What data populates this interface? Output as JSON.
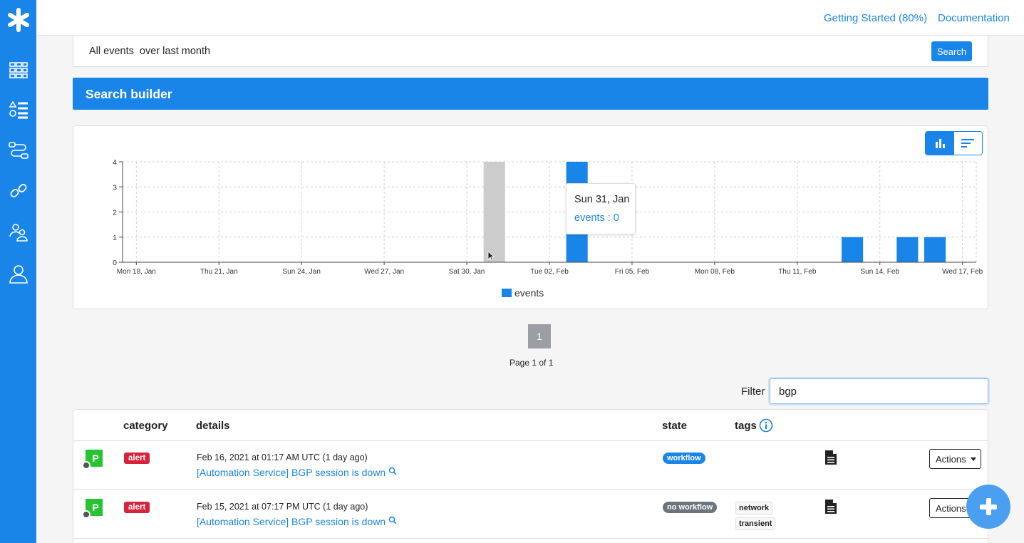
{
  "topbar": {
    "getting_started": "Getting Started (80%)",
    "documentation": "Documentation"
  },
  "sidebar": {
    "items": [
      {
        "name": "dashboard-icon"
      },
      {
        "name": "incidents-list-icon"
      },
      {
        "name": "workflows-icon"
      },
      {
        "name": "integrations-link-icon"
      },
      {
        "name": "teams-icon"
      },
      {
        "name": "user-profile-icon"
      }
    ]
  },
  "search": {
    "query": "All events  over last month",
    "button": "Search"
  },
  "builder": {
    "title": "Search builder"
  },
  "chart_data": {
    "type": "bar",
    "series": [
      {
        "name": "events",
        "values_by_date": [
          {
            "date": "2021-02-03",
            "value": 4
          },
          {
            "date": "2021-02-13",
            "value": 1
          },
          {
            "date": "2021-02-15",
            "value": 1
          },
          {
            "date": "2021-02-16",
            "value": 1
          }
        ]
      }
    ],
    "x_tick_labels": [
      "Mon 18, Jan",
      "Thu 21, Jan",
      "Sun 24, Jan",
      "Wed 27, Jan",
      "Sat 30, Jan",
      "Tue 02, Feb",
      "Fri 05, Feb",
      "Mon 08, Feb",
      "Thu 11, Feb",
      "Sun 14, Feb",
      "Wed 17, Feb"
    ],
    "x_tick_dates": [
      "2021-01-18",
      "2021-01-21",
      "2021-01-24",
      "2021-01-27",
      "2021-01-30",
      "2021-02-02",
      "2021-02-05",
      "2021-02-08",
      "2021-02-11",
      "2021-02-14",
      "2021-02-17"
    ],
    "x_range": [
      "2021-01-18",
      "2021-02-18"
    ],
    "y_ticks": [
      0,
      1,
      2,
      3,
      4
    ],
    "ylim": [
      0,
      4
    ],
    "hover_date": "2021-01-31",
    "grid": true,
    "legend": "bottom-center",
    "bar_color": "#1a85e8",
    "hover_color": "#cccccc"
  },
  "tooltip": {
    "date": "Sun 31, Jan",
    "value": "events : 0"
  },
  "pagination": {
    "current": "1",
    "info": "Page 1 of 1"
  },
  "filter": {
    "label": "Filter",
    "value": "bgp"
  },
  "table": {
    "headers": {
      "category": "category",
      "details": "details",
      "state": "state",
      "tags": "tags"
    },
    "rows": [
      {
        "source_letter": "P",
        "category": "alert",
        "date": "Feb 16, 2021 at 01:17 AM UTC (1 day ago)",
        "title": "[Automation Service] BGP session is down",
        "state": "workflow",
        "state_color": "#1a85e8",
        "tags": [],
        "actions": "Actions"
      },
      {
        "source_letter": "P",
        "category": "alert",
        "date": "Feb 15, 2021 at 07:17 PM UTC (1 day ago)",
        "title": "[Automation Service] BGP session is down",
        "state": "no workflow",
        "state_color": "#6c757d",
        "tags": [
          "network",
          "transient"
        ],
        "actions": "Actions"
      }
    ]
  },
  "colors": {
    "accent": "#1a85e8",
    "alert": "#d6223a",
    "source": "#25c430"
  }
}
